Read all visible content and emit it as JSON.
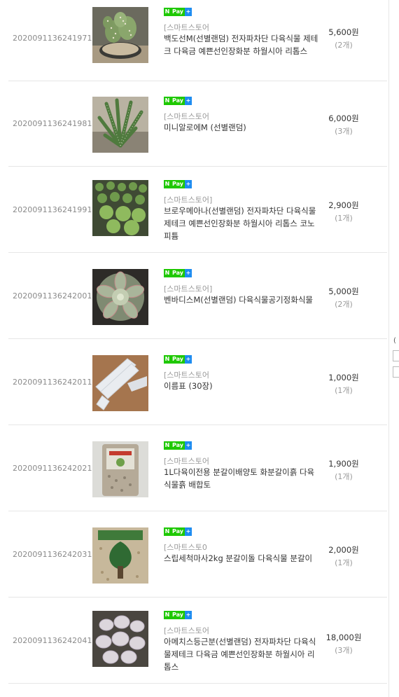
{
  "badge": {
    "n": "N",
    "pay": "Pay",
    "plus": "+"
  },
  "side": {
    "partial_text": "("
  },
  "items": [
    {
      "order_no": "2020091136241971",
      "store": "[스마트스토어",
      "name": "백도선M(선별랜덤) 전자파차단 다육식물 제테크 다육금 예쁜선인장화분 하월시아 리톱스",
      "price": "5,600원",
      "qty": "(2개)",
      "image": "bunny-ear-cactus"
    },
    {
      "order_no": "2020091136241981",
      "store": "[스마트스토어",
      "name": "미니알로에M (선별랜덤)",
      "price": "6,000원",
      "qty": "(3개)",
      "image": "mini-aloe"
    },
    {
      "order_no": "2020091136241991",
      "store": "[스마트스토어]",
      "name": "브로우메아나(선별랜덤) 전자파차단 다육식물제테크 예쁜선인장화분 하월시아 리톱스 코노피튬",
      "price": "2,900원",
      "qty": "(1개)",
      "image": "succulent-tray"
    },
    {
      "order_no": "2020091136242001",
      "store": "[스마트스토어]",
      "name": "벤바디스M(선별랜덤) 다육식물공기정화식물",
      "price": "5,000원",
      "qty": "(2개)",
      "image": "echeveria-rosette"
    },
    {
      "order_no": "2020091136242011",
      "store": "[스마트스토어",
      "name": "이름표 (30장)",
      "price": "1,000원",
      "qty": "(1개)",
      "image": "plant-labels"
    },
    {
      "order_no": "2020091136242021",
      "store": "[스마트스토어",
      "name": "1L다육이전용 분갈이배양토 화분갈이흙 다육식물흙 배합토",
      "price": "1,900원",
      "qty": "(1개)",
      "image": "soil-bag"
    },
    {
      "order_no": "2020091136242031",
      "store": "[스마트스토0",
      "name": "스립세척마사2kg 분갈이돌 다육식물 분갈이",
      "price": "2,000원",
      "qty": "(1개)",
      "image": "gravel-bag"
    },
    {
      "order_no": "2020091136242041",
      "store": "[스마트스토어",
      "name": "아메치스등근분(선별랜덤) 전자파차단 다육식물제테크 다육금 예쁜선인장화분 하월시아 리톱스",
      "price": "18,000원",
      "qty": "(3개)",
      "image": "pachyphytum-cluster"
    }
  ]
}
